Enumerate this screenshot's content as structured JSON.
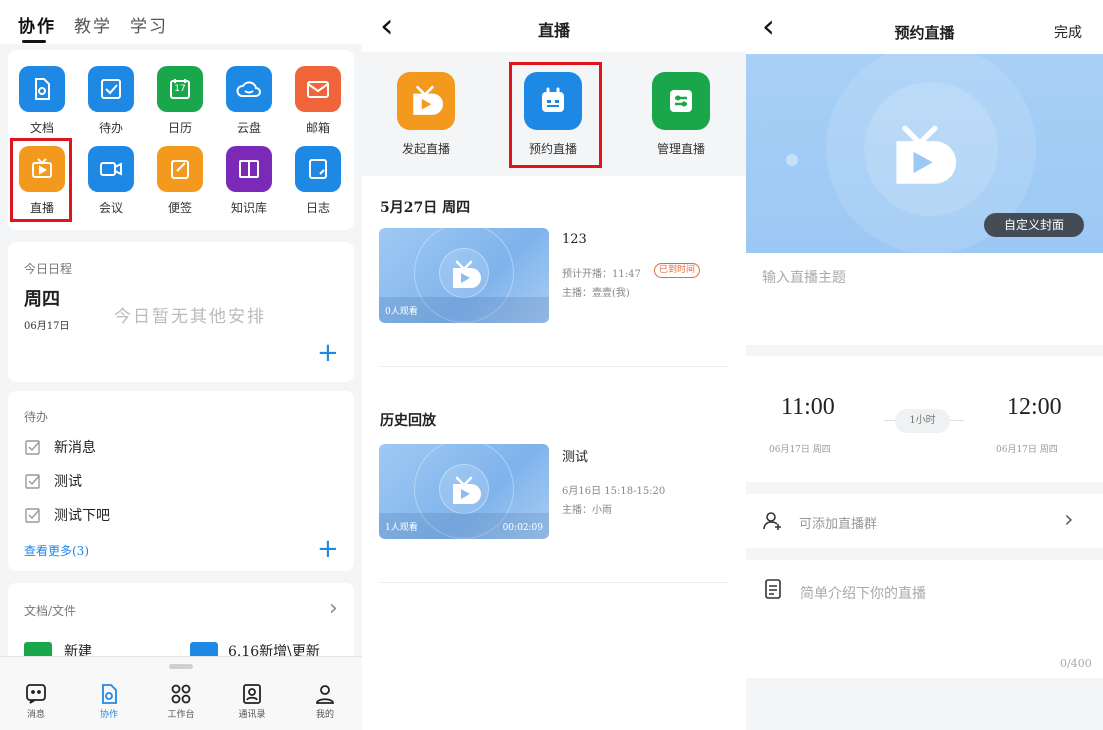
{
  "panel1": {
    "tabs": [
      "协作",
      "教学",
      "学习"
    ],
    "apps": [
      {
        "label": "文档",
        "color": "#1e88e5",
        "icon": "document-icon"
      },
      {
        "label": "待办",
        "color": "#1e88e5",
        "icon": "todo-check-icon"
      },
      {
        "label": "日历",
        "color": "#1aa64a",
        "icon": "calendar-icon",
        "badge": "17"
      },
      {
        "label": "云盘",
        "color": "#1e88e5",
        "icon": "cloud-icon"
      },
      {
        "label": "邮箱",
        "color": "#f0643a",
        "icon": "mail-icon"
      },
      {
        "label": "直播",
        "color": "#f39a1e",
        "icon": "live-tv-icon"
      },
      {
        "label": "会议",
        "color": "#1e88e5",
        "icon": "video-camera-icon"
      },
      {
        "label": "便签",
        "color": "#f39a1e",
        "icon": "note-icon"
      },
      {
        "label": "知识库",
        "color": "#7b2ab8",
        "icon": "book-icon"
      },
      {
        "label": "日志",
        "color": "#1e88e5",
        "icon": "log-icon"
      }
    ],
    "schedule": {
      "heading": "今日日程",
      "weekday": "周四",
      "date": "06月17日",
      "empty": "今日暂无其他安排",
      "add": "+"
    },
    "todo": {
      "heading": "待办",
      "items": [
        "新消息",
        "测试",
        "测试下吧"
      ],
      "more": "查看更多(3)",
      "add": "+"
    },
    "files": {
      "heading": "文档/文件",
      "chevron": "›",
      "items": [
        "新建",
        "6.16新增\\更新"
      ]
    },
    "nav": [
      {
        "label": "消息",
        "icon": "message-icon"
      },
      {
        "label": "协作",
        "icon": "collab-icon"
      },
      {
        "label": "工作台",
        "icon": "workbench-icon"
      },
      {
        "label": "通讯录",
        "icon": "contacts-icon"
      },
      {
        "label": "我的",
        "icon": "profile-icon"
      }
    ],
    "colors": {
      "accent": "#1e88e5",
      "highlight": "#e0151b"
    }
  },
  "panel2": {
    "title": "直播",
    "back": "‹",
    "actions": [
      {
        "label": "发起直播",
        "color": "#f39a1e",
        "icon": "start-live-icon"
      },
      {
        "label": "预约直播",
        "color": "#1e88e5",
        "icon": "schedule-live-icon"
      },
      {
        "label": "管理直播",
        "color": "#1aa64a",
        "icon": "manage-live-icon"
      }
    ],
    "upcoming": {
      "date": "5月27日  周四",
      "title": "123",
      "time": "预计开播：11:47",
      "badge": "已到时间",
      "host": "主播：壹壹(我)",
      "viewers": "0人观看"
    },
    "history": {
      "heading": "历史回放",
      "title": "测试",
      "time": "6月16日  15:18-15:20",
      "host": "主播：小雨",
      "viewers": "1人观看",
      "duration": "00:02:09"
    }
  },
  "panel3": {
    "title": "预约直播",
    "back": "‹",
    "done": "完成",
    "cover_button": "自定义封面",
    "topic_placeholder": "输入直播主题",
    "start_time": "11:00",
    "start_date": "06月17日  周四",
    "end_time": "12:00",
    "end_date": "06月17日  周四",
    "duration": "1小时",
    "group": "可添加直播群",
    "group_chevron": "›",
    "intro_placeholder": "简单介绍下你的直播",
    "counter": "0/400"
  }
}
